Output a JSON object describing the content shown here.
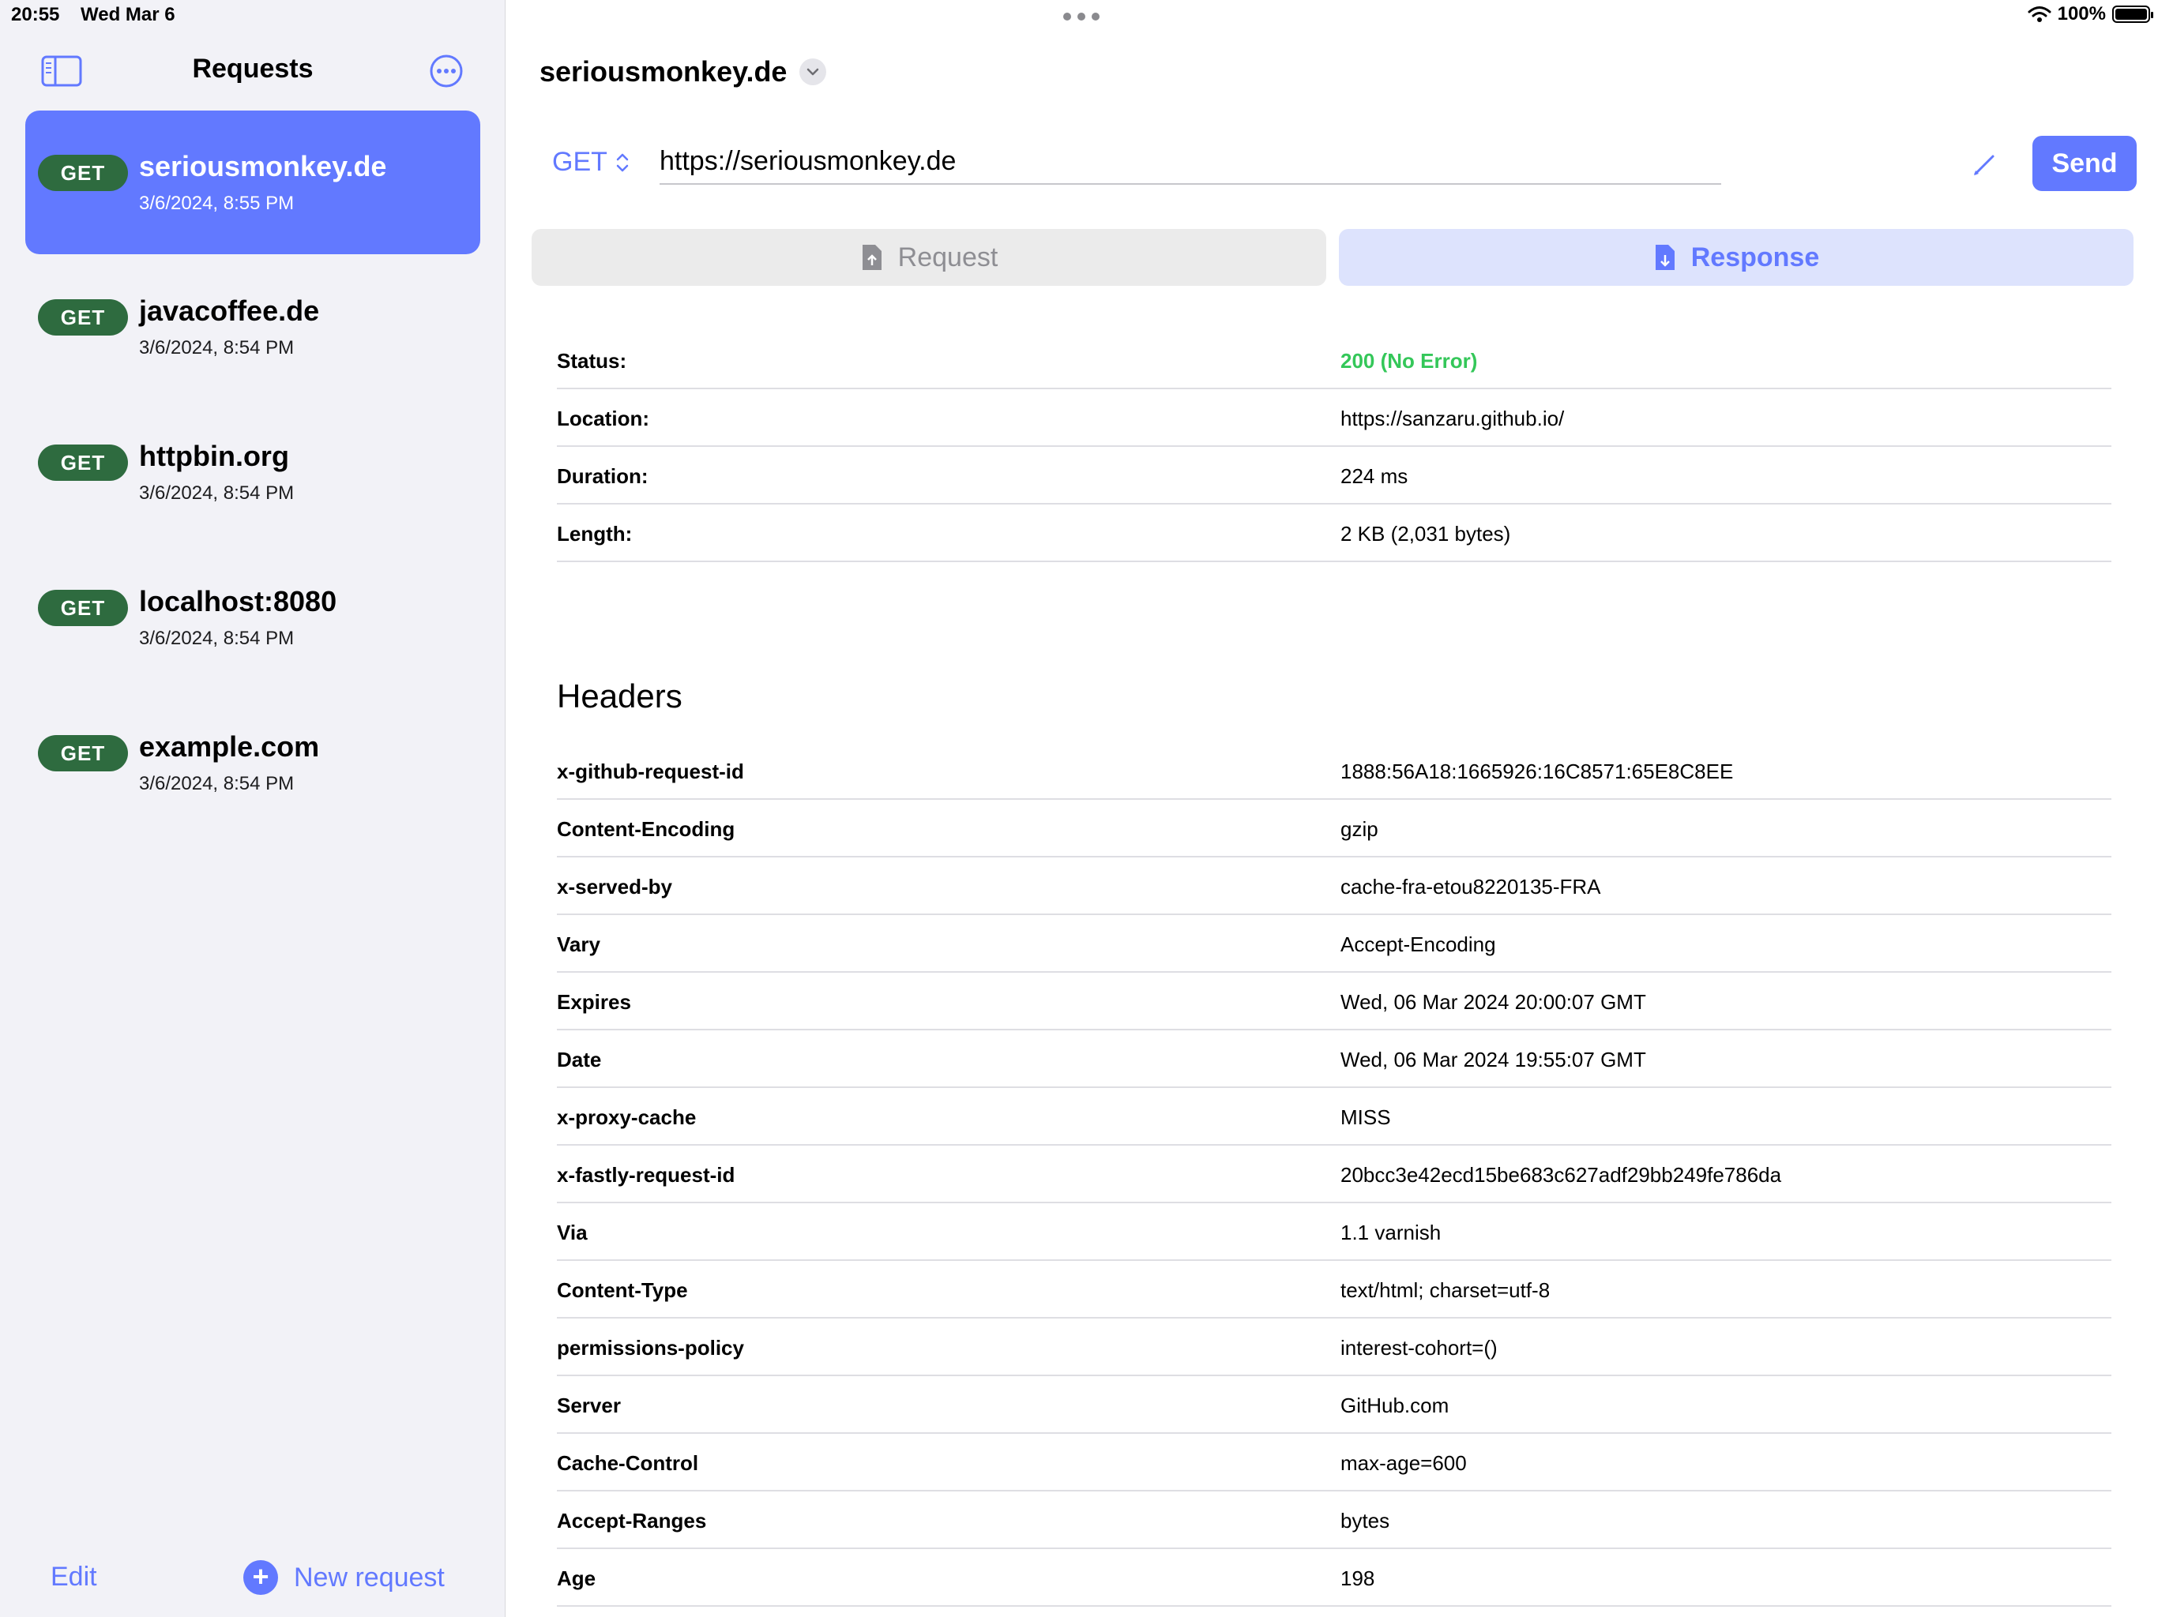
{
  "status_bar": {
    "time": "20:55",
    "date": "Wed Mar 6",
    "battery": "100%"
  },
  "sidebar": {
    "title": "Requests",
    "items": [
      {
        "method": "GET",
        "host": "seriousmonkey.de",
        "date": "3/6/2024, 8:55 PM",
        "selected": true
      },
      {
        "method": "GET",
        "host": "javacoffee.de",
        "date": "3/6/2024, 8:54 PM"
      },
      {
        "method": "GET",
        "host": "httpbin.org",
        "date": "3/6/2024, 8:54 PM"
      },
      {
        "method": "GET",
        "host": "localhost:8080",
        "date": "3/6/2024, 8:54 PM"
      },
      {
        "method": "GET",
        "host": "example.com",
        "date": "3/6/2024, 8:54 PM"
      }
    ],
    "edit_label": "Edit",
    "new_request_label": "New request"
  },
  "main": {
    "title": "seriousmonkey.de",
    "method": "GET",
    "url": "https://seriousmonkey.de",
    "send_label": "Send",
    "tabs": [
      {
        "label": "Request",
        "active": false
      },
      {
        "label": "Response",
        "active": true
      }
    ],
    "summary": [
      {
        "key": "Status:",
        "value": "200 (No Error)"
      },
      {
        "key": "Location:",
        "value": "https://sanzaru.github.io/"
      },
      {
        "key": "Duration:",
        "value": "224 ms"
      },
      {
        "key": "Length:",
        "value": "2 KB (2,031 bytes)"
      }
    ],
    "headers_title": "Headers",
    "headers": [
      {
        "key": "x-github-request-id",
        "value": "1888:56A18:1665926:16C8571:65E8C8EE"
      },
      {
        "key": "Content-Encoding",
        "value": "gzip"
      },
      {
        "key": "x-served-by",
        "value": "cache-fra-etou8220135-FRA"
      },
      {
        "key": "Vary",
        "value": "Accept-Encoding"
      },
      {
        "key": "Expires",
        "value": "Wed, 06 Mar 2024 20:00:07 GMT"
      },
      {
        "key": "Date",
        "value": "Wed, 06 Mar 2024 19:55:07 GMT"
      },
      {
        "key": "x-proxy-cache",
        "value": "MISS"
      },
      {
        "key": "x-fastly-request-id",
        "value": "20bcc3e42ecd15be683c627adf29bb249fe786da"
      },
      {
        "key": "Via",
        "value": "1.1 varnish"
      },
      {
        "key": "Content-Type",
        "value": "text/html; charset=utf-8"
      },
      {
        "key": "permissions-policy",
        "value": "interest-cohort=()"
      },
      {
        "key": "Server",
        "value": "GitHub.com"
      },
      {
        "key": "Cache-Control",
        "value": "max-age=600"
      },
      {
        "key": "Accept-Ranges",
        "value": "bytes"
      },
      {
        "key": "Age",
        "value": "198"
      }
    ]
  },
  "colors": {
    "accent": "#6279ff",
    "badge_green": "#2e6b3f",
    "status_ok": "#34c759"
  }
}
